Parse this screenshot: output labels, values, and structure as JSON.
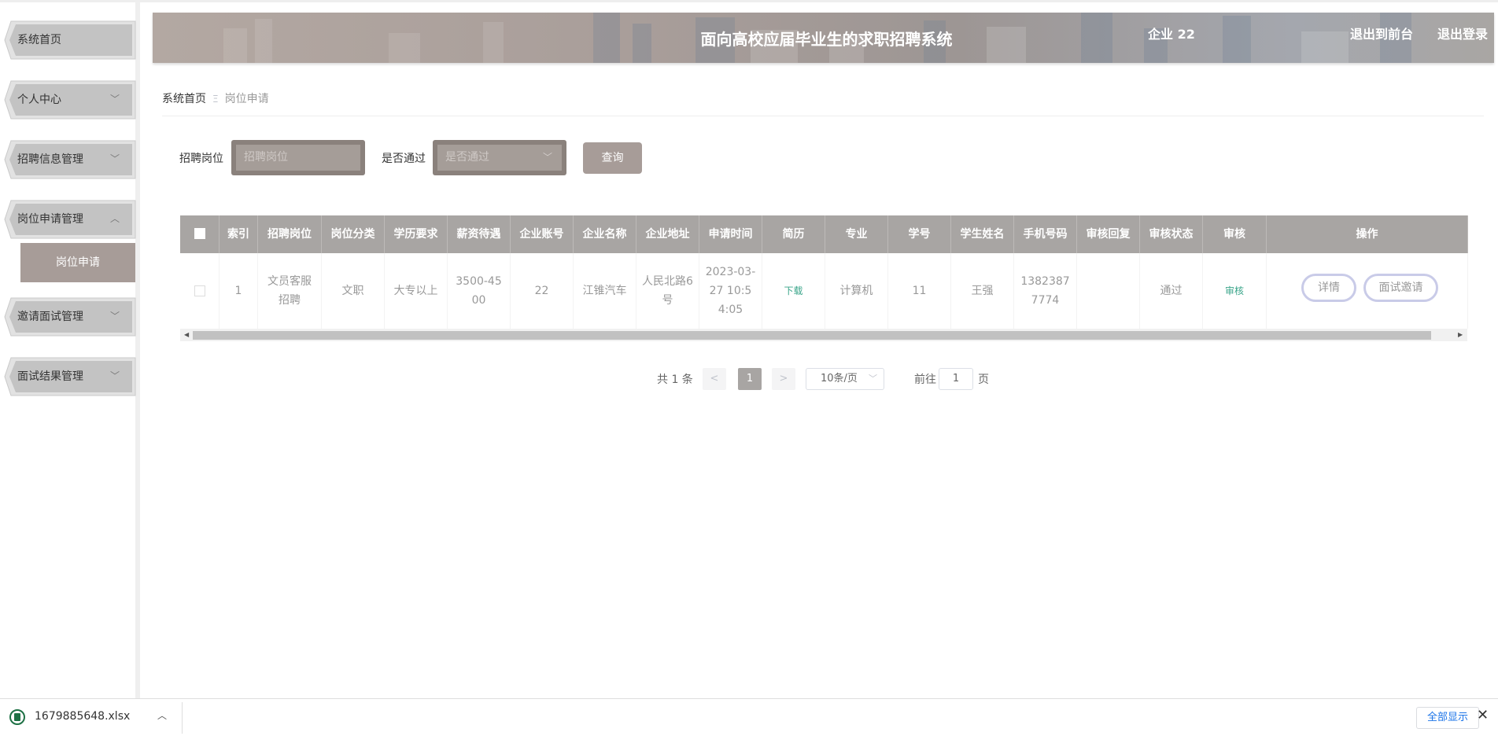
{
  "header": {
    "title": "面向高校应届毕业生的求职招聘系统",
    "user": "企业 22",
    "back_to_front": "退出到前台",
    "logout": "退出登录"
  },
  "sidebar": {
    "items": [
      {
        "label": "系统首页",
        "expandable": false
      },
      {
        "label": "个人中心",
        "expandable": true
      },
      {
        "label": "招聘信息管理",
        "expandable": true
      },
      {
        "label": "岗位申请管理",
        "expandable": true,
        "expanded": true
      },
      {
        "label": "邀请面试管理",
        "expandable": true
      },
      {
        "label": "面试结果管理",
        "expandable": true
      }
    ],
    "active_sub": "岗位申请",
    "chevron_down": "﹀",
    "chevron_up": "︿"
  },
  "breadcrumb": {
    "home": "系统首页",
    "separator": "Ξ",
    "current": "岗位申请"
  },
  "search": {
    "position_label": "招聘岗位",
    "position_placeholder": "招聘岗位",
    "pass_label": "是否通过",
    "pass_placeholder": "是否通过",
    "query_button": "查询"
  },
  "table": {
    "columns": [
      "索引",
      "招聘岗位",
      "岗位分类",
      "学历要求",
      "薪资待遇",
      "企业账号",
      "企业名称",
      "企业地址",
      "申请时间",
      "简历",
      "专业",
      "学号",
      "学生姓名",
      "手机号码",
      "审核回复",
      "审核状态",
      "审核",
      "操作"
    ],
    "rows": [
      {
        "index": "1",
        "position": "文员客服招聘",
        "category": "文职",
        "education": "大专以上",
        "salary": "3500-4500",
        "company_account": "22",
        "company_name": "江锥汽车",
        "company_address": "人民北路6号",
        "apply_time": "2023-03-27 10:54:05",
        "resume": "下载",
        "major": "计算机",
        "student_no": "11",
        "student_name": "王强",
        "phone": "13823877774",
        "review_reply": "",
        "review_status": "通过",
        "review": "审核",
        "detail_btn": "详情",
        "invite_btn": "面试邀请"
      }
    ]
  },
  "pagination": {
    "total": "共 1 条",
    "prev": "<",
    "current_page": "1",
    "next": ">",
    "page_size": "10条/页",
    "goto_label": "前往",
    "goto_value": "1",
    "page_unit": "页"
  },
  "download_bar": {
    "file_name": "1679885648.xlsx",
    "show_all": "全部显示"
  },
  "colors": {
    "accent": "#a79c98",
    "header_bg": "#a8a5a3",
    "success_text": "#3aa58a",
    "button_ring": "#c9cbe8"
  }
}
